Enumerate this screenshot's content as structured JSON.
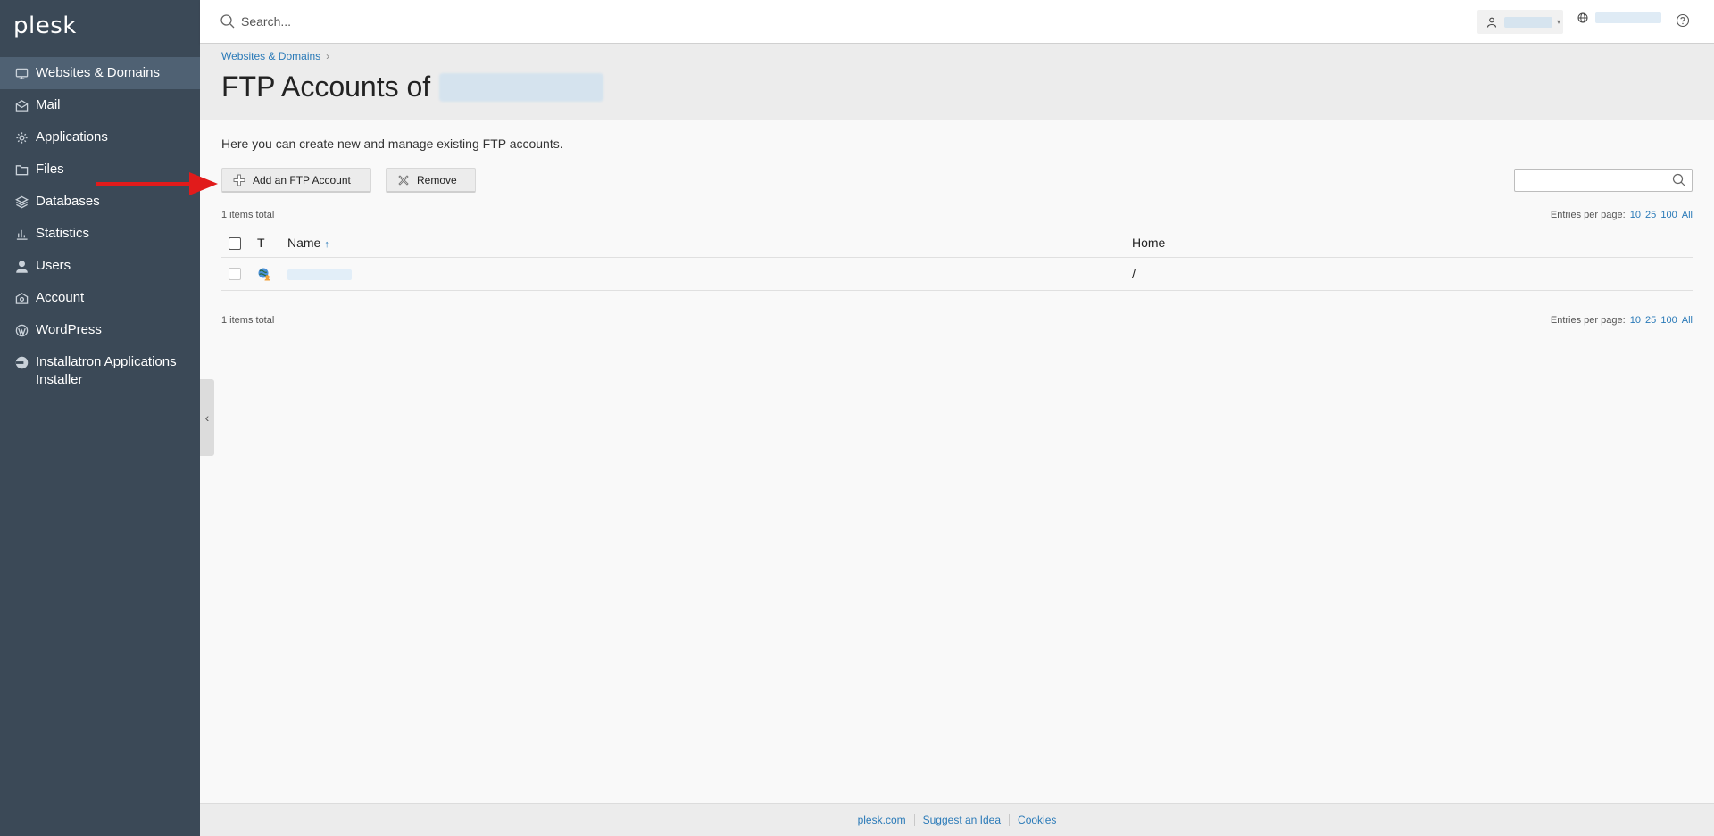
{
  "app": {
    "logo": "plesk"
  },
  "sidebar": {
    "items": [
      {
        "label": "Websites & Domains",
        "icon": "monitor-icon",
        "active": true
      },
      {
        "label": "Mail",
        "icon": "mail-icon"
      },
      {
        "label": "Applications",
        "icon": "gear-icon"
      },
      {
        "label": "Files",
        "icon": "folder-icon"
      },
      {
        "label": "Databases",
        "icon": "layers-icon"
      },
      {
        "label": "Statistics",
        "icon": "bar-chart-icon"
      },
      {
        "label": "Users",
        "icon": "user-icon"
      },
      {
        "label": "Account",
        "icon": "account-icon"
      },
      {
        "label": "WordPress",
        "icon": "wordpress-icon"
      },
      {
        "label": "Installatron Applications Installer",
        "icon": "installatron-icon"
      }
    ]
  },
  "topbar": {
    "search_placeholder": "Search..."
  },
  "breadcrumb": {
    "item": "Websites & Domains"
  },
  "page": {
    "title": "FTP Accounts of",
    "intro": "Here you can create new and manage existing FTP accounts."
  },
  "toolbar": {
    "add_label": "Add an FTP Account",
    "remove_label": "Remove"
  },
  "list": {
    "total_top": "1 items total",
    "total_bottom": "1 items total",
    "per_page_label": "Entries per page:",
    "per_page_options": [
      "10",
      "25",
      "100",
      "All"
    ],
    "columns": {
      "type": "T",
      "name": "Name",
      "home": "Home"
    },
    "rows": [
      {
        "home": "/"
      }
    ]
  },
  "footer": {
    "links": [
      "plesk.com",
      "Suggest an Idea",
      "Cookies"
    ]
  },
  "colors": {
    "sidebar": "#3b4957",
    "sidebar_active": "#4f6173",
    "link": "#2a7ab8",
    "annotation_arrow": "#e11b1b"
  }
}
